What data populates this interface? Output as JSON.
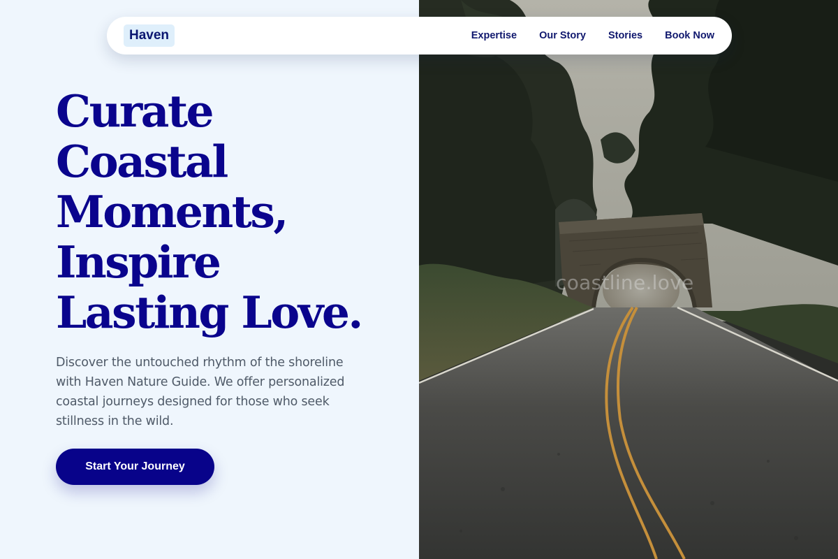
{
  "brand": {
    "name": "Haven"
  },
  "nav": {
    "links": [
      {
        "label": "Expertise"
      },
      {
        "label": "Our Story"
      },
      {
        "label": "Stories"
      },
      {
        "label": "Book Now"
      }
    ]
  },
  "hero": {
    "headline_lines": [
      "Curate",
      "Coastal",
      "Moments,",
      "Inspire",
      "Lasting Love."
    ],
    "description": "Discover the untouched rhythm of the shoreline with Haven Nature Guide. We offer personalized coastal journeys designed for those who seek stillness in the wild.",
    "cta_label": "Start Your Journey",
    "image_watermark": "coastline.love"
  },
  "colors": {
    "accent": "#08038a",
    "headline": "#0a048d",
    "nav_text": "#10186e",
    "body_text": "#4f5a68",
    "page_background": "#eff6fd",
    "logo_background": "#dfeffb"
  }
}
